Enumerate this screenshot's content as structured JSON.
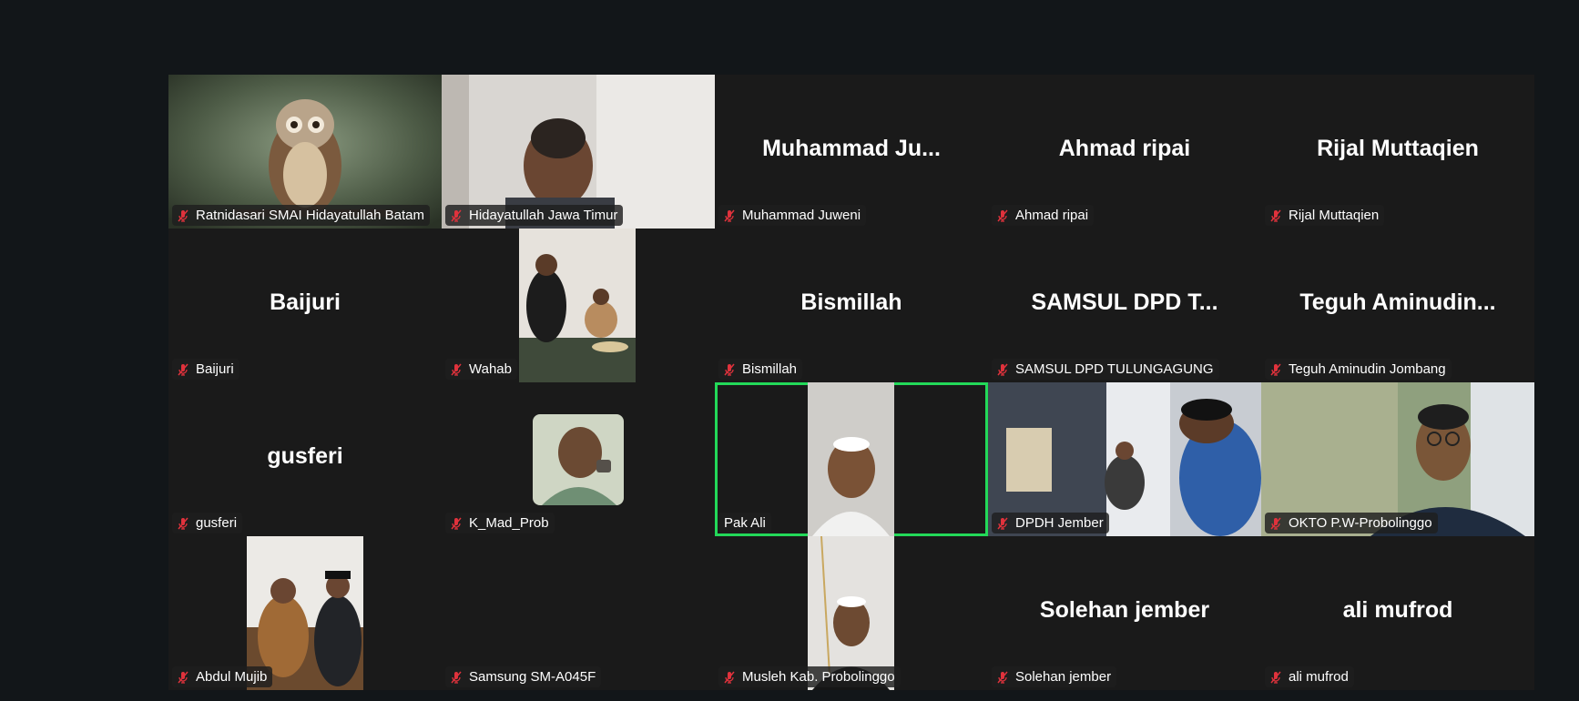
{
  "meeting": {
    "participants": [
      {
        "display": "",
        "label": "Ratnidasari SMAI Hidayatullah Batam",
        "muted": true,
        "video": "owl"
      },
      {
        "display": "",
        "label": "Hidayatullah Jawa Timur",
        "muted": true,
        "video": "man-room"
      },
      {
        "display": "Muhammad  Ju...",
        "label": "Muhammad Juweni",
        "muted": true,
        "video": ""
      },
      {
        "display": "Ahmad ripai",
        "label": "Ahmad ripai",
        "muted": true,
        "video": ""
      },
      {
        "display": "Rijal Muttaqien",
        "label": "Rijal Muttaqien",
        "muted": true,
        "video": ""
      },
      {
        "display": "Baijuri",
        "label": "Baijuri",
        "muted": true,
        "video": ""
      },
      {
        "display": "",
        "label": "Wahab",
        "muted": true,
        "video": "seated-men"
      },
      {
        "display": "Bismillah",
        "label": "Bismillah",
        "muted": true,
        "video": ""
      },
      {
        "display": "SAMSUL DPD T...",
        "label": "SAMSUL DPD TULUNGAGUNG",
        "muted": true,
        "video": ""
      },
      {
        "display": "Teguh  Aminudin...",
        "label": "Teguh Aminudin Jombang",
        "muted": true,
        "video": ""
      },
      {
        "display": "gusferi",
        "label": "gusferi",
        "muted": true,
        "video": ""
      },
      {
        "display": "",
        "label": "K_Mad_Prob",
        "muted": true,
        "video": "avatar-photo"
      },
      {
        "display": "",
        "label": "Pak Ali",
        "muted": false,
        "video": "man-cap",
        "active": true
      },
      {
        "display": "",
        "label": "DPDH Jember",
        "muted": true,
        "video": "room-group"
      },
      {
        "display": "",
        "label": "OKTO P.W-Probolinggo",
        "muted": true,
        "video": "man-glasses"
      },
      {
        "display": "",
        "label": "Abdul Mujib",
        "muted": true,
        "video": "two-men"
      },
      {
        "display": "",
        "label": "Samsung SM-A045F",
        "muted": true,
        "video": "blank"
      },
      {
        "display": "",
        "label": "Musleh Kab. Probolinggo",
        "muted": true,
        "video": "man-black"
      },
      {
        "display": "Solehan jember",
        "label": "Solehan jember",
        "muted": true,
        "video": ""
      },
      {
        "display": "ali mufrod",
        "label": "ali mufrod",
        "muted": true,
        "video": ""
      }
    ]
  },
  "colors": {
    "background": "#121619",
    "tile": "#1a1a1a",
    "active_speaker_border": "#23d959",
    "mic_muted": "#e0323c"
  },
  "icons": {
    "muted_mic": "mic-off-icon"
  }
}
